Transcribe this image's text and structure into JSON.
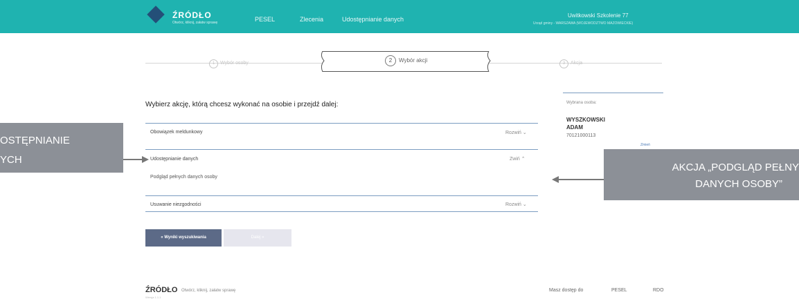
{
  "header": {
    "logo_title": "ŹRÓDŁO",
    "logo_subtitle": "Otwórz, kliknij, załatw sprawę",
    "nav": [
      "PESEL",
      "Zlecenia",
      "Udostępnianie danych"
    ],
    "user_name": "Uwitkowski Szkolenie 77",
    "user_sub": "Urząd gminy - WARSZAWA (WOJEWODZTWO MAZOWIECKIE)"
  },
  "stepper": {
    "step1": {
      "num": "1",
      "label": "Wybór osoby"
    },
    "step2": {
      "num": "2",
      "label": "Wybór akcji"
    },
    "step3": {
      "num": "3",
      "label": "Akcja"
    }
  },
  "main": {
    "title": "Wybierz akcję, którą chcesz wykonać na osobie i przejdź dalej:",
    "accordion": [
      {
        "label": "Obowiązek meldunkowy",
        "toggle": "Rozwiń ⌄"
      },
      {
        "label": "Udostępnianie danych",
        "toggle": "Zwiń ⌃",
        "content": "Podgląd pełnych danych osoby"
      },
      {
        "label": "Usuwanie niezgodności",
        "toggle": "Rozwiń ⌄"
      }
    ],
    "back_button": "« Wyniki wyszukiwania",
    "next_button": "Dalej »"
  },
  "side": {
    "label": "Wybrana osoba:",
    "surname": "WYSZKOWSKI",
    "firstname": "ADAM",
    "pesel": "70121000113",
    "link": "Zmień"
  },
  "callouts": {
    "left": [
      "OSTĘPNIANIE",
      "YCH"
    ],
    "right": [
      "AKCJA „PODGLĄD PEŁNY",
      "DANYCH OSOBY”"
    ]
  },
  "footer": {
    "logo": "ŹRÓDŁO",
    "tagline": "Otwórz, kliknij, załatw sprawę",
    "version": "Wersja 1.1.1",
    "access_label": "Masz dostęp do",
    "links": [
      "PESEL",
      "RDO"
    ]
  },
  "colors": {
    "header": "#1fb3b0",
    "primary_button": "#5c6a87",
    "callout": "#8c9097"
  }
}
